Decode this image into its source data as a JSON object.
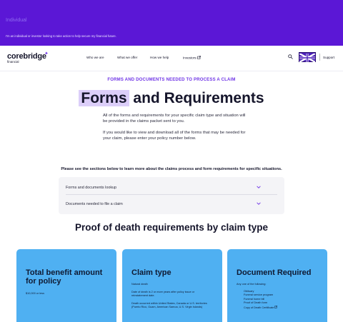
{
  "banner": {
    "title": "Individual",
    "text": "I'm an individual or investor looking to take action to help secure my financial future."
  },
  "nav": {
    "logo_main": "corebridge",
    "logo_sub": "financial",
    "links": [
      "Who we are",
      "What we offer",
      "How we help",
      "Investors"
    ],
    "support": "Support",
    "accent": "#6f34e6"
  },
  "hero": {
    "eyebrow": "FORMS AND DOCUMENTS NEEDED TO PROCESS A CLAIM",
    "title_highlight": "Forms",
    "title_rest": " and Requirements",
    "para1": "All of the forms and requirements for your specific claim type and situation will be provided in the claims packet sent to you.",
    "para2": "If you would like to view and download all of the forms that may be needed for your claim, please enter your policy number below."
  },
  "sections_note": "Please see the sections below to learn more about the claims process and form requirements for specific situations.",
  "accordion": {
    "items": [
      "Forms and documents lookup",
      "Documents needed to file a claim"
    ]
  },
  "section_title": "Proof of death requirements by claim type",
  "cards": [
    {
      "title": "Total benefit amount for policy",
      "lines": [
        "$10,000 or less"
      ]
    },
    {
      "title": "Claim type",
      "lines": [
        "Natural death",
        "Date of death is 2 or more years after policy issue or reinstatement date.",
        "Death occurred within United States, Canada or U.S. territories (Puerto Rico, Guam, American Samoa, U.S. Virgin Islands)"
      ]
    },
    {
      "title": "Document Required",
      "lines": [
        "Any one of the following:"
      ],
      "list": [
        "Obituary",
        "Funeral service program",
        "Funeral home bill",
        "Proof of Death form",
        "Copy of Death Certificate"
      ]
    }
  ]
}
